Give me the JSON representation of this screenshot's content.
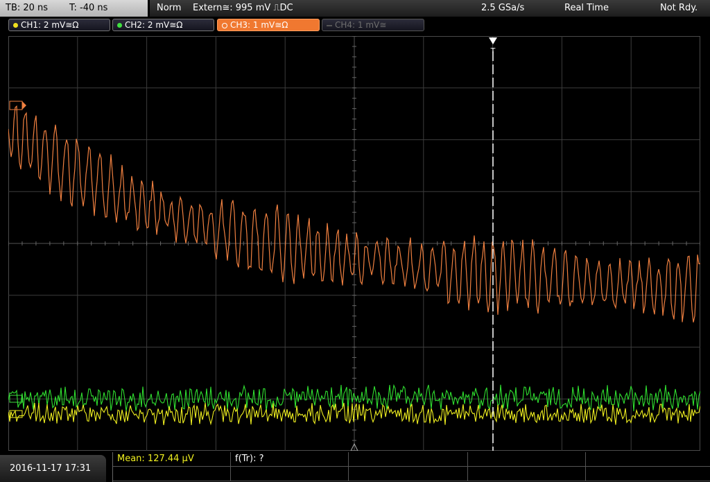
{
  "top": {
    "timebase": "TB: 20 ns",
    "trigger_offset": "T: -40 ns",
    "mode": "Norm",
    "trigger_source": "Extern≅: 995 mV ⎍DC",
    "sample_rate": "2.5 GSa/s",
    "acq_mode": "Real Time",
    "status": "Not Rdy."
  },
  "channels": [
    {
      "label": "CH1: 2 mV≅Ω",
      "color": "#f0e020"
    },
    {
      "label": "CH2: 2 mV≅Ω",
      "color": "#40e040"
    },
    {
      "label": "CH3: 1 mV≅Ω",
      "color": "#f07830"
    },
    {
      "label": "CH4: 1 mV≅",
      "color": "#6e6e6e"
    }
  ],
  "trigger_marker": "T",
  "measurement": {
    "mean": "Mean: 127.44 µV",
    "ftr": "f(Tr): ?"
  },
  "date": "2016-11-17 17:31",
  "colors": {
    "ch1": "#f0f020",
    "ch2": "#30e030",
    "ch3": "#f08040",
    "grid": "#3c3c3c",
    "mean_text": "#f0f020"
  }
}
